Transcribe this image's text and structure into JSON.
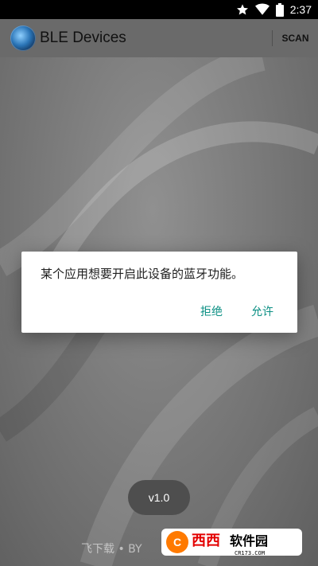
{
  "status_bar": {
    "time": "2:37",
    "icons": [
      "star-icon",
      "wifi-icon",
      "battery-icon"
    ]
  },
  "app_bar": {
    "title": "BLE Devices",
    "scan_label": "SCAN"
  },
  "dialog": {
    "message": "某个应用想要开启此设备的蓝牙功能。",
    "deny_label": "拒绝",
    "allow_label": "允许"
  },
  "version_badge": {
    "label": "v1.0"
  },
  "watermark": {
    "text": "飞下载 • BY",
    "logo_text": "西西软件园",
    "logo_url_text": "CR173.COM"
  },
  "colors": {
    "accent": "#0a8f83",
    "app_bar": "#6a6a6a",
    "status_bar": "#000000"
  }
}
